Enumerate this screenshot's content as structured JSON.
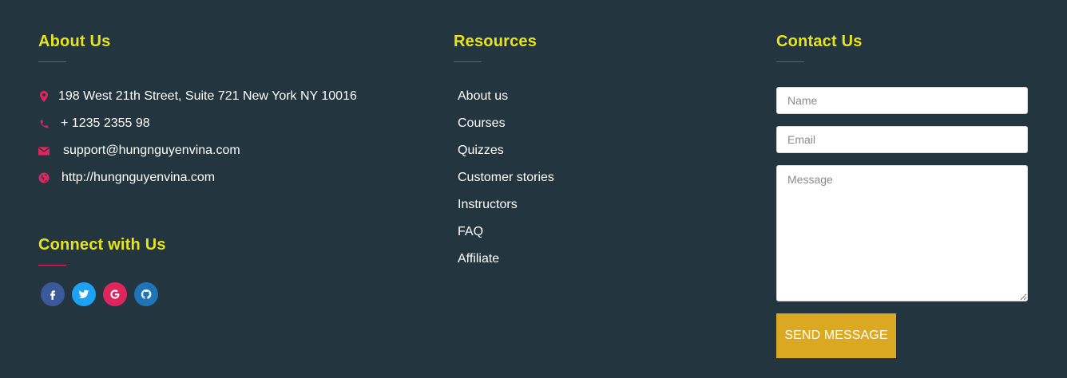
{
  "about": {
    "heading": "About Us",
    "items": [
      {
        "icon": "map-pin-icon",
        "text": "198 West 21th Street, Suite 721 New York NY 10016"
      },
      {
        "icon": "phone-icon",
        "text": "+ 1235 2355 98"
      },
      {
        "icon": "envelope-icon",
        "text": "support@hungnguyenvina.com"
      },
      {
        "icon": "globe-icon",
        "text": "http://hungnguyenvina.com"
      }
    ]
  },
  "connect": {
    "heading": "Connect with Us",
    "socials": [
      {
        "icon": "facebook-icon",
        "color": "#3b5998"
      },
      {
        "icon": "twitter-icon",
        "color": "#1da1f2"
      },
      {
        "icon": "google-icon",
        "color": "#e0245e"
      },
      {
        "icon": "github-icon",
        "color": "#1f73b7"
      }
    ]
  },
  "resources": {
    "heading": "Resources",
    "items": [
      "About us",
      "Courses",
      "Quizzes",
      "Customer stories",
      "Instructors",
      "FAQ",
      "Affiliate"
    ]
  },
  "contact": {
    "heading": "Contact Us",
    "name_placeholder": "Name",
    "email_placeholder": "Email",
    "message_placeholder": "Message",
    "button_label": "SEND MESSAGE"
  },
  "colors": {
    "background": "#233640",
    "heading": "#e7e31e",
    "accent": "#e0245e",
    "button": "#dba822"
  }
}
